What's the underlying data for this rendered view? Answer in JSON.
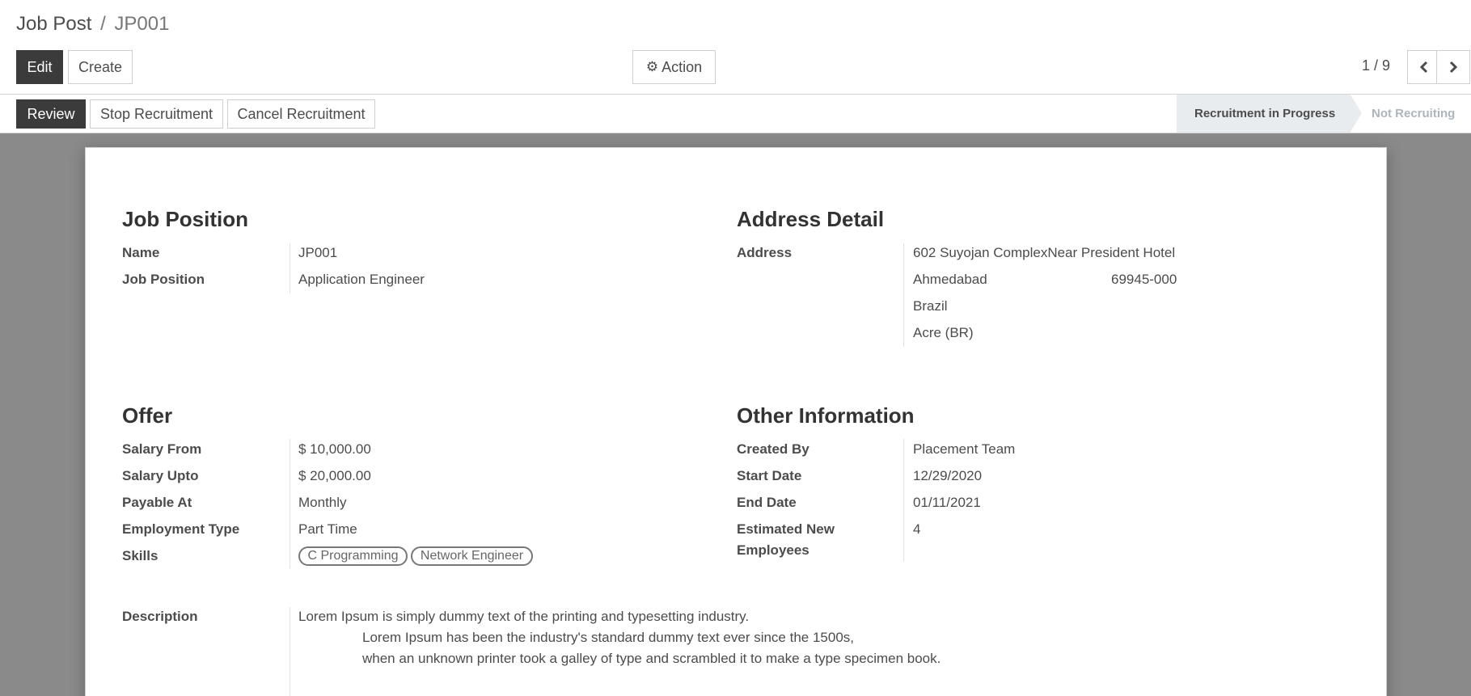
{
  "breadcrumb": {
    "parent": "Job Post",
    "separator": "/",
    "current": "JP001"
  },
  "toolbar": {
    "edit_label": "Edit",
    "create_label": "Create",
    "action_label": "Action"
  },
  "pager": {
    "value": "1 / 9"
  },
  "status_buttons": {
    "review": "Review",
    "stop": "Stop Recruitment",
    "cancel": "Cancel Recruitment"
  },
  "stages": {
    "active": "Recruitment in Progress",
    "next": "Not Recruiting"
  },
  "job_position": {
    "title": "Job Position",
    "name_label": "Name",
    "name_value": "JP001",
    "position_label": "Job Position",
    "position_value": "Application Engineer"
  },
  "address_detail": {
    "title": "Address Detail",
    "address_label": "Address",
    "street": "602 Suyojan ComplexNear President Hotel",
    "city": "Ahmedabad",
    "zip": "69945-000",
    "country": "Brazil",
    "state": "Acre (BR)"
  },
  "offer": {
    "title": "Offer",
    "salary_from_label": "Salary From",
    "salary_from_value": "$ 10,000.00",
    "salary_upto_label": "Salary Upto",
    "salary_upto_value": "$ 20,000.00",
    "payable_label": "Payable At",
    "payable_value": "Monthly",
    "employment_label": "Employment Type",
    "employment_value": "Part Time",
    "skills_label": "Skills",
    "skills": [
      "C Programming",
      "Network Engineer"
    ]
  },
  "other_info": {
    "title": "Other Information",
    "created_by_label": "Created By",
    "created_by_value": "Placement Team",
    "start_label": "Start Date",
    "start_value": "12/29/2020",
    "end_label": "End Date",
    "end_value": "01/11/2021",
    "estimated_label_line1": "Estimated New",
    "estimated_label_line2": "Employees",
    "estimated_value": "4"
  },
  "description": {
    "label": "Description",
    "line1": "Lorem Ipsum is simply dummy text of the printing and typesetting industry.",
    "line2": "Lorem Ipsum has been the industry's standard dummy text ever since the 1500s,",
    "line3": "when an unknown printer took a galley of type and scrambled it to make a type specimen book."
  },
  "icons": {
    "action": "gear-icon",
    "prev": "chevron-left-icon",
    "next": "chevron-right-icon"
  }
}
